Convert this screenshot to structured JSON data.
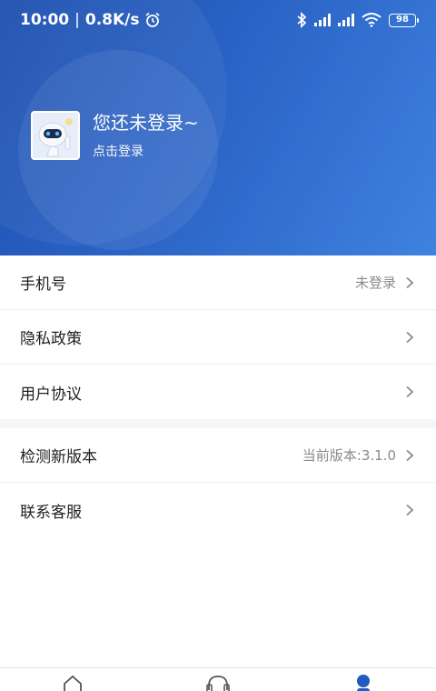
{
  "status_bar": {
    "time": "10:00",
    "speed": "0.8K/s",
    "battery": "98",
    "icons": [
      "alarm-icon",
      "bluetooth-icon",
      "signal-hd-icon",
      "signal-hd-icon",
      "wifi-icon",
      "battery-icon"
    ]
  },
  "profile": {
    "title": "您还未登录~",
    "login_link": "点击登录",
    "avatar_icon": "robot-avatar-icon"
  },
  "menu": {
    "phone": {
      "label": "手机号",
      "value": "未登录"
    },
    "privacy": {
      "label": "隐私政策"
    },
    "agreement": {
      "label": "用户协议"
    },
    "update": {
      "label": "检测新版本",
      "value": "当前版本:3.1.0"
    },
    "support": {
      "label": "联系客服"
    }
  },
  "tabbar": {
    "tabs": [
      {
        "icon": "home-icon",
        "active": false
      },
      {
        "icon": "headset-icon",
        "active": false
      },
      {
        "icon": "user-icon",
        "active": true
      }
    ]
  },
  "colors": {
    "header_start": "#1c4fb0",
    "header_end": "#3f82e0",
    "active_tab": "#1f5bc1",
    "inactive_tab": "#555555",
    "chevron": "#8a8a8a"
  }
}
